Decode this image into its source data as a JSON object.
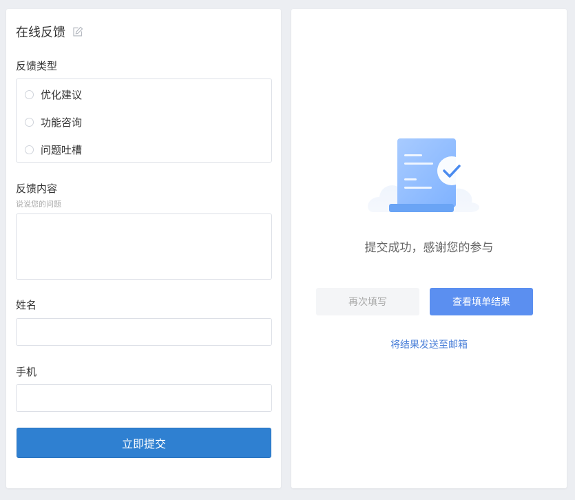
{
  "form": {
    "title": "在线反馈",
    "title_icon": "edit-icon",
    "feedback_type_label": "反馈类型",
    "feedback_type_options": [
      "优化建议",
      "功能咨询",
      "问题吐槽"
    ],
    "content_label": "反馈内容",
    "content_hint": "说说您的问题",
    "content_value": "",
    "name_label": "姓名",
    "name_value": "",
    "phone_label": "手机",
    "phone_value": "",
    "submit_label": "立即提交"
  },
  "result": {
    "illustration": "document-check-icon",
    "message": "提交成功，感谢您的参与",
    "refill_label": "再次填写",
    "view_result_label": "查看填单结果",
    "email_link_label": "将结果发送至邮箱"
  },
  "colors": {
    "submit": "#2f80d1",
    "primary": "#5b8ff0",
    "link": "#4a7fd8",
    "background": "#eceef2"
  }
}
